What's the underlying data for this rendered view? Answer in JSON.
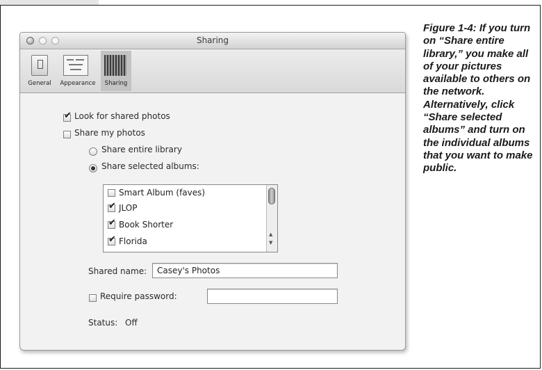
{
  "window": {
    "title": "Sharing",
    "toolbar": [
      {
        "label": "General",
        "icon": "general-icon"
      },
      {
        "label": "Appearance",
        "icon": "appearance-icon"
      },
      {
        "label": "Sharing",
        "icon": "sharing-icon",
        "selected": true
      }
    ]
  },
  "sharing": {
    "look_for_shared_photos": {
      "label": "Look for shared photos",
      "checked": true
    },
    "share_my_photos": {
      "label": "Share my photos",
      "checked": false
    },
    "share_entire_library": {
      "label": "Share entire library",
      "selected": false
    },
    "share_selected_albums": {
      "label": "Share selected albums:",
      "selected": true
    },
    "albums": [
      {
        "label": "Smart Album (faves)",
        "checked": false
      },
      {
        "label": "JLOP",
        "checked": true
      },
      {
        "label": "Book Shorter",
        "checked": true
      },
      {
        "label": "Florida",
        "checked": true
      }
    ],
    "shared_name": {
      "label": "Shared name:",
      "value": "Casey's Photos"
    },
    "require_password": {
      "label": "Require password:",
      "checked": false,
      "value": ""
    },
    "status": {
      "label": "Status:",
      "value": "Off"
    }
  },
  "caption": "Figure 1-4: If you turn on “Share entire library,” you make all of your pictures available to others on the network. Alternatively, click “Share selected albums” and turn on the individual albums that you want to make public."
}
